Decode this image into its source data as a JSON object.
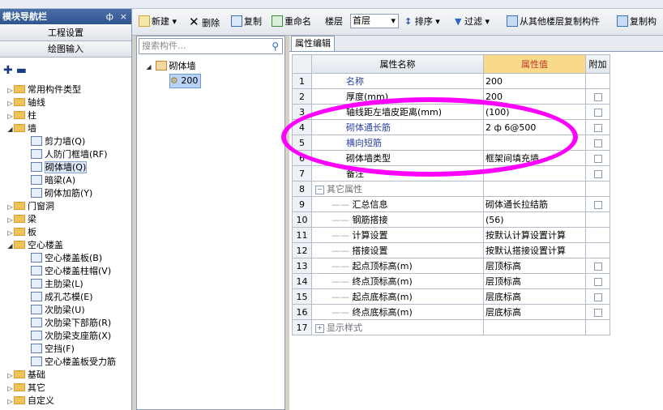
{
  "nav": {
    "title": "模块导航栏",
    "pin": "ф",
    "close": "×",
    "btn_project": "工程设置",
    "btn_draw": "绘图输入",
    "tools": "+ −"
  },
  "nav_tree": [
    {
      "label": "常用构件类型",
      "exp": "▷",
      "type": "folder"
    },
    {
      "label": "轴线",
      "exp": "▷",
      "type": "folder"
    },
    {
      "label": "柱",
      "exp": "▷",
      "type": "folder"
    },
    {
      "label": "墙",
      "exp": "◢",
      "type": "folder"
    },
    {
      "label": "剪力墙(Q)",
      "exp": "",
      "type": "item"
    },
    {
      "label": "人防门框墙(RF)",
      "exp": "",
      "type": "item"
    },
    {
      "label": "砌体墙(Q)",
      "exp": "",
      "type": "item",
      "selected": true
    },
    {
      "label": "暗梁(A)",
      "exp": "",
      "type": "item"
    },
    {
      "label": "砌体加筋(Y)",
      "exp": "",
      "type": "item"
    },
    {
      "label": "门窗洞",
      "exp": "▷",
      "type": "folder"
    },
    {
      "label": "梁",
      "exp": "▷",
      "type": "folder"
    },
    {
      "label": "板",
      "exp": "▷",
      "type": "folder"
    },
    {
      "label": "空心楼盖",
      "exp": "◢",
      "type": "folder"
    },
    {
      "label": "空心楼盖板(B)",
      "exp": "",
      "type": "item"
    },
    {
      "label": "空心楼盖柱帽(V)",
      "exp": "",
      "type": "item"
    },
    {
      "label": "主肋梁(L)",
      "exp": "",
      "type": "item"
    },
    {
      "label": "成孔芯模(E)",
      "exp": "",
      "type": "item"
    },
    {
      "label": "次肋梁(U)",
      "exp": "",
      "type": "item"
    },
    {
      "label": "次肋梁下部筋(R)",
      "exp": "",
      "type": "item"
    },
    {
      "label": "次肋梁支座筋(X)",
      "exp": "",
      "type": "item"
    },
    {
      "label": "空挡(F)",
      "exp": "",
      "type": "item"
    },
    {
      "label": "空心楼盖板受力筋",
      "exp": "",
      "type": "item"
    },
    {
      "label": "基础",
      "exp": "▷",
      "type": "folder"
    },
    {
      "label": "其它",
      "exp": "▷",
      "type": "folder"
    },
    {
      "label": "自定义",
      "exp": "▷",
      "type": "folder"
    }
  ],
  "toolbar": {
    "new": "新建",
    "delete": "删除",
    "copy": "复制",
    "rename": "重命名",
    "floor_label": "楼层",
    "floor_value": "首层",
    "sort": "排序",
    "filter": "过滤",
    "copy_from_floor": "从其他楼层复制构件",
    "copy_comp": "复制构"
  },
  "search": {
    "placeholder": "搜索构件..."
  },
  "comp_tree": {
    "root": "砌体墙",
    "child": "200"
  },
  "props": {
    "tab": "属性编辑",
    "col_name": "属性名称",
    "col_value": "属性值",
    "col_extra": "附加",
    "rows": [
      {
        "n": "1",
        "name": "名称",
        "value": "200",
        "style": "blue",
        "check": false
      },
      {
        "n": "2",
        "name": "厚度(mm)",
        "value": "200",
        "style": "",
        "check": true
      },
      {
        "n": "3",
        "name": "轴线距左墙皮距离(mm)",
        "value": "(100)",
        "style": "",
        "check": true
      },
      {
        "n": "4",
        "name": "砌体通长筋",
        "value": "2 ф 6@500",
        "style": "blue",
        "check": true
      },
      {
        "n": "5",
        "name": "横向短筋",
        "value": "",
        "style": "blue",
        "check": true
      },
      {
        "n": "6",
        "name": "砌体墙类型",
        "value": "框架间填充墙",
        "style": "",
        "check": true
      },
      {
        "n": "7",
        "name": "备注",
        "value": "",
        "style": "",
        "check": true
      },
      {
        "n": "8",
        "name": "其它属性",
        "value": "",
        "style": "gray",
        "check": false,
        "group": true
      },
      {
        "n": "9",
        "name": "汇总信息",
        "value": "砌体通长拉结筋",
        "style": "",
        "check": true,
        "indent": true
      },
      {
        "n": "10",
        "name": "钢筋搭接",
        "value": "(56)",
        "style": "",
        "check": false,
        "indent": true
      },
      {
        "n": "11",
        "name": "计算设置",
        "value": "按默认计算设置计算",
        "style": "",
        "check": false,
        "indent": true
      },
      {
        "n": "12",
        "name": "搭接设置",
        "value": "按默认搭接设置计算",
        "style": "",
        "check": false,
        "indent": true
      },
      {
        "n": "13",
        "name": "起点顶标高(m)",
        "value": "层顶标高",
        "style": "",
        "check": true,
        "indent": true
      },
      {
        "n": "14",
        "name": "终点顶标高(m)",
        "value": "层顶标高",
        "style": "",
        "check": true,
        "indent": true
      },
      {
        "n": "15",
        "name": "起点底标高(m)",
        "value": "层底标高",
        "style": "",
        "check": true,
        "indent": true
      },
      {
        "n": "16",
        "name": "终点底标高(m)",
        "value": "层底标高",
        "style": "",
        "check": true,
        "indent": true
      },
      {
        "n": "17",
        "name": "显示样式",
        "value": "",
        "style": "gray",
        "check": false,
        "group": true,
        "plus": true
      }
    ]
  },
  "colors": {
    "highlight": "#ff00ff",
    "value_header": "#f9d98a"
  }
}
